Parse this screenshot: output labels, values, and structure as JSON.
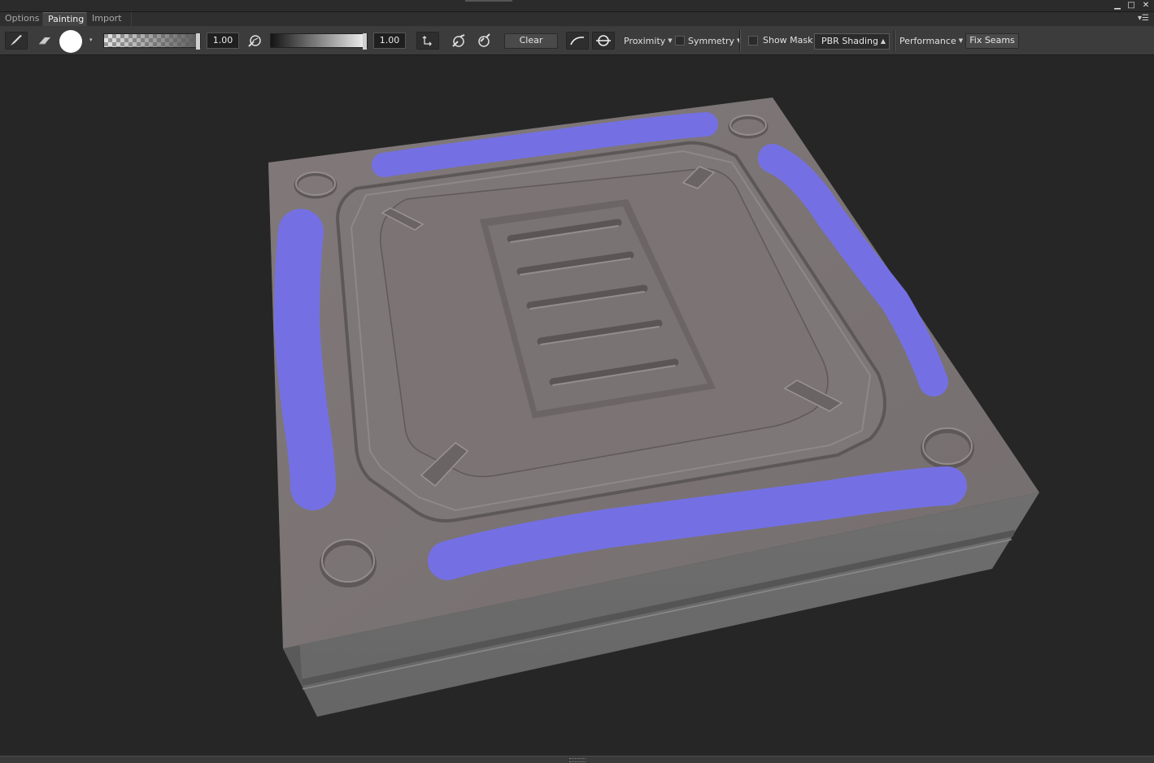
{
  "tabs": [
    {
      "label": "Options"
    },
    {
      "label": "Painting"
    },
    {
      "label": "Import"
    }
  ],
  "toolbar": {
    "opacity_value": "1.00",
    "strength_value": "1.00",
    "clear_label": "Clear",
    "proximity_label": "Proximity",
    "symmetry_label": "Symmetry",
    "show_mask_label": "Show Mask",
    "shading_selected": "PBR Shading",
    "performance_label": "Performance",
    "fix_seams_label": "Fix Seams"
  },
  "colors": {
    "paint_stroke": "#7470e3",
    "mesh_top": "#7b7473",
    "toolbar_bg": "#3c3c3c",
    "viewport_bg": "#262626"
  },
  "icons": [
    "brush-icon",
    "eraser-icon",
    "brush-tip-icon",
    "dropper-icon",
    "swap-icon",
    "pick-icon",
    "target-icon",
    "curve-icon",
    "ring-icon"
  ]
}
